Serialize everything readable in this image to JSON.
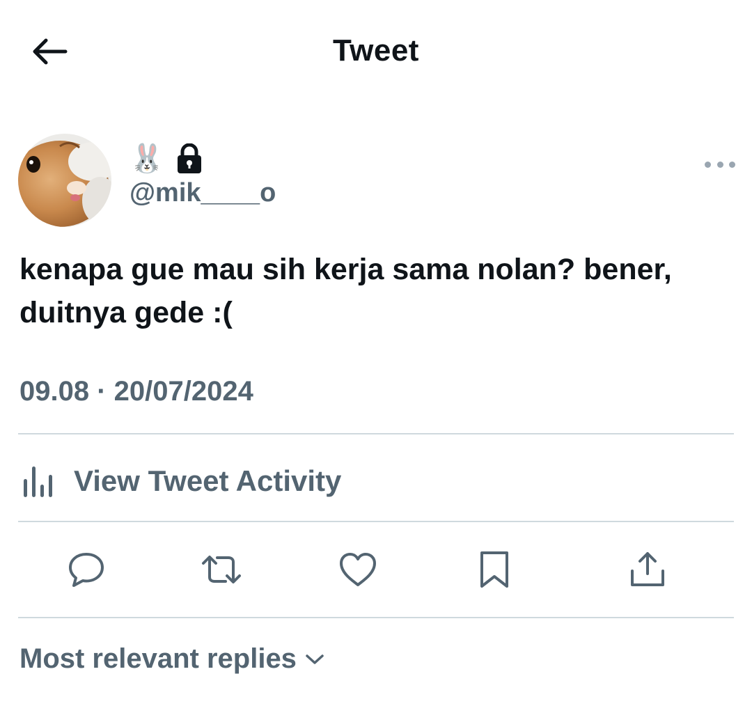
{
  "header": {
    "title": "Tweet",
    "back_icon": "arrow-left-icon"
  },
  "author": {
    "name_emoji": "🐰",
    "protected_icon": "lock-icon",
    "handle": "@mik____o",
    "more_icon": "more-horizontal-icon"
  },
  "tweet": {
    "text": "kenapa gue mau sih kerja sama nolan? bener, duitnya gede :(",
    "timestamp": "09.08 · 20/07/2024"
  },
  "activity": {
    "label": "View Tweet Activity",
    "icon": "bar-chart-icon"
  },
  "actions": {
    "icons": [
      "reply-icon",
      "retweet-icon",
      "like-icon",
      "bookmark-icon",
      "share-icon"
    ]
  },
  "replies": {
    "label": "Most relevant replies",
    "icon": "chevron-down-icon"
  },
  "colors": {
    "text_primary": "#0f1419",
    "text_secondary": "#536471",
    "divider": "#cfd9de",
    "icon": "#536471"
  }
}
